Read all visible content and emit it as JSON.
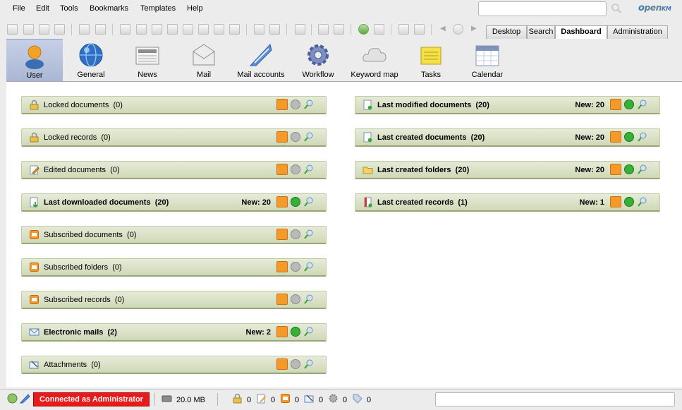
{
  "menu": [
    "File",
    "Edit",
    "Tools",
    "Bookmarks",
    "Templates",
    "Help"
  ],
  "search": {
    "value": ""
  },
  "logo": {
    "part1": "o",
    "part2": "pen",
    "part3": "KM"
  },
  "main_tabs": [
    {
      "label": "Desktop",
      "active": false
    },
    {
      "label": "Search",
      "active": false
    },
    {
      "label": "Dashboard",
      "active": true
    },
    {
      "label": "Administration",
      "active": false
    }
  ],
  "workspace_tabs": [
    {
      "label": "User",
      "icon": "user-icon",
      "active": true
    },
    {
      "label": "General",
      "icon": "globe-icon",
      "active": false
    },
    {
      "label": "News",
      "icon": "newspaper-icon",
      "active": false
    },
    {
      "label": "Mail",
      "icon": "mail-icon",
      "active": false
    },
    {
      "label": "Mail accounts",
      "icon": "mail-accounts-icon",
      "active": false
    },
    {
      "label": "Workflow",
      "icon": "gear-icon",
      "active": false
    },
    {
      "label": "Keyword map",
      "icon": "cloud-icon",
      "active": false
    },
    {
      "label": "Tasks",
      "icon": "notepad-icon",
      "active": false
    },
    {
      "label": "Calendar",
      "icon": "calendar-icon",
      "active": false
    }
  ],
  "left_panels": [
    {
      "title": "Locked documents",
      "count": "(0)",
      "new": "",
      "icon": "padlock-icon",
      "status": "grey"
    },
    {
      "title": "Locked records",
      "count": "(0)",
      "new": "",
      "icon": "padlock-icon",
      "status": "grey"
    },
    {
      "title": "Edited documents",
      "count": "(0)",
      "new": "",
      "icon": "edit-document-icon",
      "status": "grey"
    },
    {
      "title": "Last downloaded documents",
      "count": "(20)",
      "new": "New: 20",
      "icon": "download-document-icon",
      "status": "green"
    },
    {
      "title": "Subscribed documents",
      "count": "(0)",
      "new": "",
      "icon": "subscription-icon",
      "status": "grey"
    },
    {
      "title": "Subscribed folders",
      "count": "(0)",
      "new": "",
      "icon": "subscription-icon",
      "status": "grey"
    },
    {
      "title": "Subscribed records",
      "count": "(0)",
      "new": "",
      "icon": "subscription-icon",
      "status": "grey"
    },
    {
      "title": "Electronic mails",
      "count": "(2)",
      "new": "New: 2",
      "icon": "envelope-icon",
      "status": "green"
    },
    {
      "title": "Attachments",
      "count": "(0)",
      "new": "",
      "icon": "attachment-icon",
      "status": "grey"
    }
  ],
  "right_panels": [
    {
      "title": "Last modified documents",
      "count": "(20)",
      "new": "New: 20",
      "icon": "document-icon",
      "status": "green"
    },
    {
      "title": "Last created documents",
      "count": "(20)",
      "new": "New: 20",
      "icon": "document-icon",
      "status": "green"
    },
    {
      "title": "Last created folders",
      "count": "(20)",
      "new": "New: 20",
      "icon": "folder-icon",
      "status": "green"
    },
    {
      "title": "Last created records",
      "count": "(1)",
      "new": "New: 1",
      "icon": "record-icon",
      "status": "green"
    }
  ],
  "status": {
    "connected": "Connected as Administrator",
    "size": "20.0 MB",
    "counters": [
      {
        "icon": "padlock-icon",
        "value": "0"
      },
      {
        "icon": "edit-icon",
        "value": "0"
      },
      {
        "icon": "subscription-icon",
        "value": "0"
      },
      {
        "icon": "attachment-icon",
        "value": "0"
      },
      {
        "icon": "gear-icon",
        "value": "0"
      },
      {
        "icon": "tag-icon",
        "value": "0"
      }
    ]
  }
}
